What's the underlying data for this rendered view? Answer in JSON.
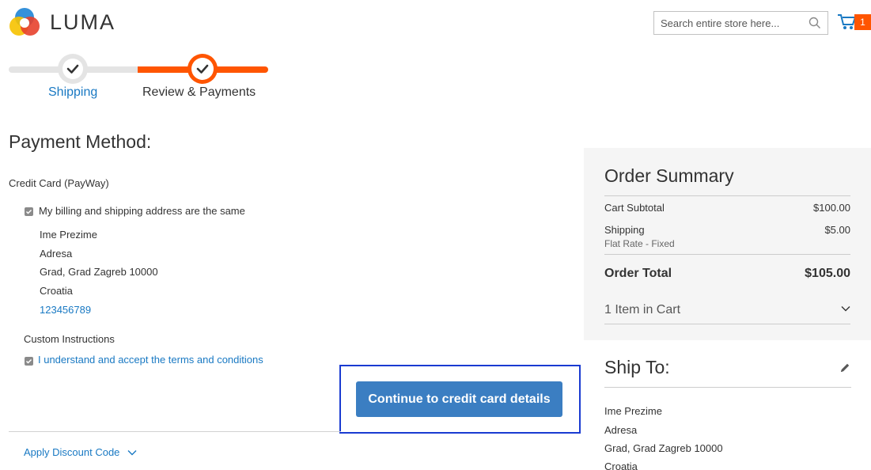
{
  "header": {
    "logo_text": "LUMA",
    "search_placeholder": "Search entire store here...",
    "cart_count": "1",
    "colors": {
      "accent": "#ff5501",
      "link": "#1979c3",
      "button": "#3b7ec2"
    }
  },
  "progress": {
    "steps": [
      {
        "label": "Shipping",
        "state": "complete"
      },
      {
        "label": "Review & Payments",
        "state": "active"
      }
    ]
  },
  "payment": {
    "title": "Payment Method:",
    "method_label": "Credit Card (PayWay)",
    "billing_same_label": "My billing and shipping address are the same",
    "billing_same_checked": true,
    "address": {
      "name": "Ime Prezime",
      "street": "Adresa",
      "city_line": "Grad, Grad Zagreb 10000",
      "country": "Croatia",
      "phone": "123456789"
    },
    "custom_instructions_label": "Custom Instructions",
    "terms_label": "I understand and accept the terms and conditions",
    "terms_checked": true,
    "continue_label": "Continue to credit card details",
    "discount_label": "Apply Discount Code"
  },
  "summary": {
    "title": "Order Summary",
    "subtotal_label": "Cart Subtotal",
    "subtotal_value": "$100.00",
    "shipping_label": "Shipping",
    "shipping_method": "Flat Rate - Fixed",
    "shipping_value": "$5.00",
    "total_label": "Order Total",
    "total_value": "$105.00",
    "items_label": "1 Item in Cart"
  },
  "ship_to": {
    "title": "Ship To:",
    "name": "Ime Prezime",
    "street": "Adresa",
    "city_line": "Grad, Grad Zagreb 10000",
    "country": "Croatia"
  }
}
